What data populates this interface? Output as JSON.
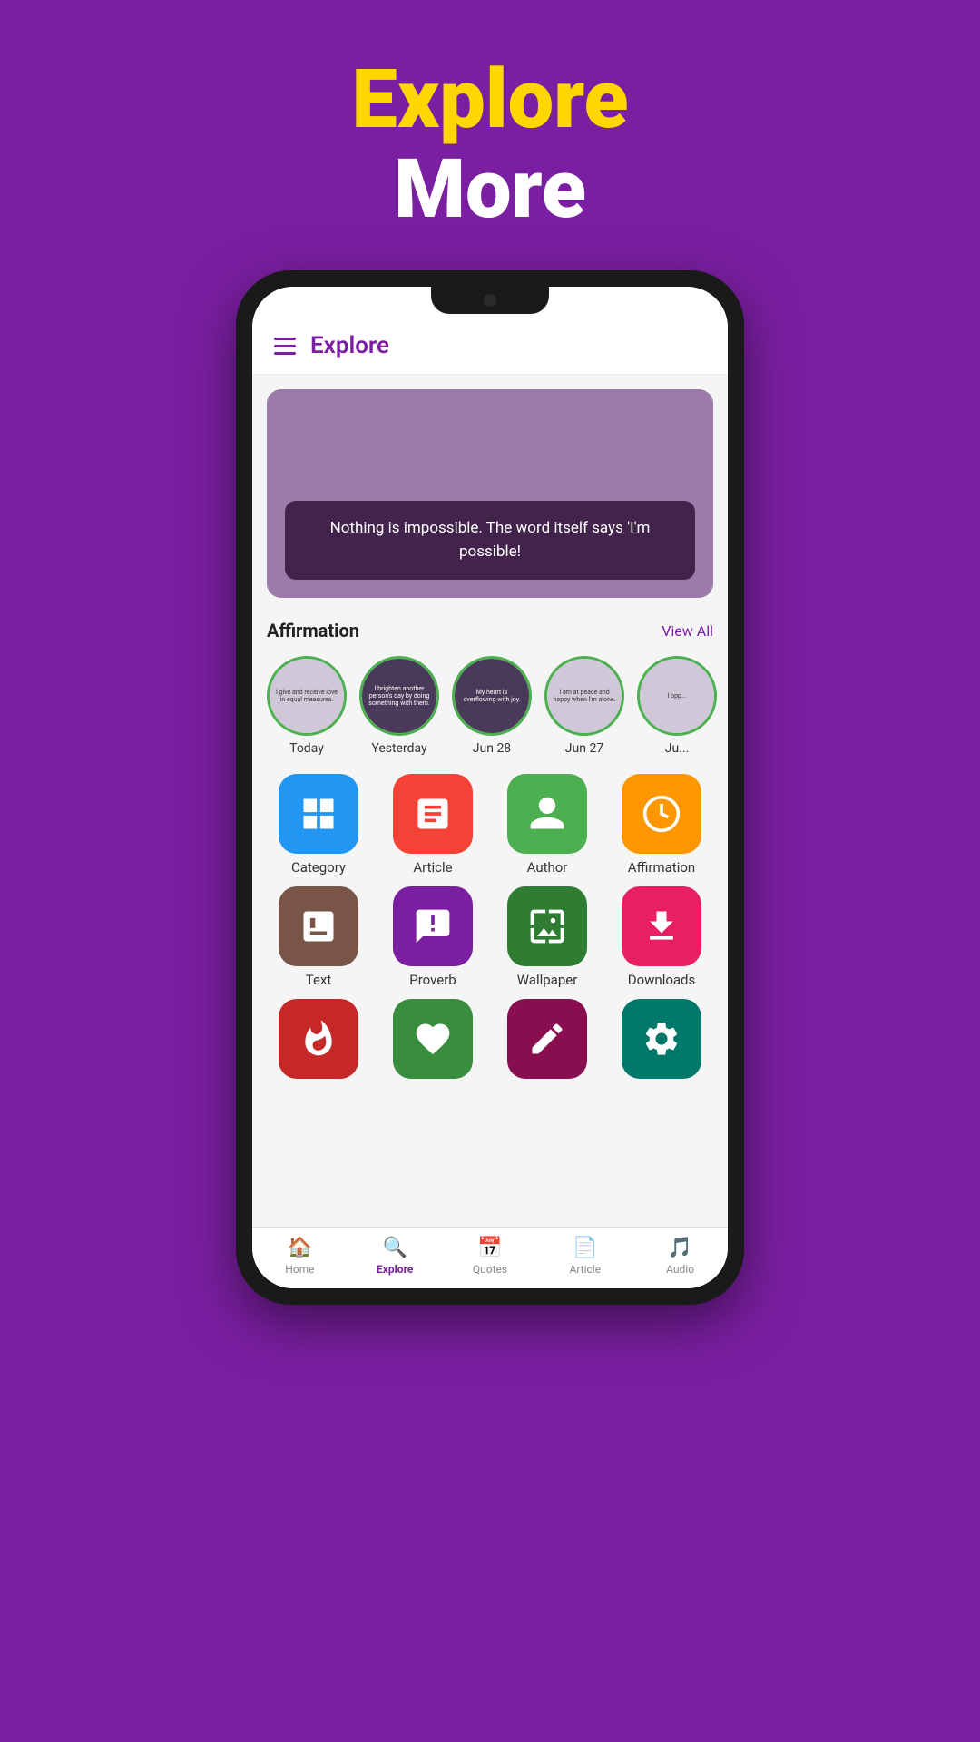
{
  "header": {
    "line1": "Explore",
    "line2": "More"
  },
  "screen": {
    "title": "Explore",
    "banner_quote": "Nothing is impossible. The word itself says 'I'm possible!",
    "affirmation_section": {
      "title": "Affirmation",
      "view_all": "View All",
      "items": [
        {
          "label": "Today",
          "text": "I give and receive love in equal measures."
        },
        {
          "label": "Yesterday",
          "text": "I brighten another person's day by doing something with them."
        },
        {
          "label": "Jun 28",
          "text": "My heart is overflowing with joy."
        },
        {
          "label": "Jun 27",
          "text": "I am at peace and happy when I'm alone."
        },
        {
          "label": "Ju...",
          "text": "I opp..."
        }
      ]
    },
    "grid_rows": [
      [
        {
          "label": "Category",
          "icon": "category",
          "color": "icon-blue"
        },
        {
          "label": "Article",
          "icon": "article",
          "color": "icon-red"
        },
        {
          "label": "Author",
          "icon": "author",
          "color": "icon-green"
        },
        {
          "label": "Affirmation",
          "icon": "affirmation",
          "color": "icon-orange"
        }
      ],
      [
        {
          "label": "Text",
          "icon": "text",
          "color": "icon-brown"
        },
        {
          "label": "Proverb",
          "icon": "proverb",
          "color": "icon-purple"
        },
        {
          "label": "Wallpaper",
          "icon": "wallpaper",
          "color": "icon-dark-green"
        },
        {
          "label": "Downloads",
          "icon": "downloads",
          "color": "icon-pink"
        }
      ],
      [
        {
          "label": "",
          "icon": "fire",
          "color": "icon-red-dark"
        },
        {
          "label": "",
          "icon": "heart",
          "color": "icon-green-mid"
        },
        {
          "label": "",
          "icon": "edit",
          "color": "icon-maroon"
        },
        {
          "label": "",
          "icon": "settings",
          "color": "icon-teal"
        }
      ]
    ],
    "nav": [
      {
        "label": "Home",
        "icon": "home",
        "active": false
      },
      {
        "label": "Explore",
        "icon": "explore",
        "active": true
      },
      {
        "label": "Quotes",
        "icon": "quotes",
        "active": false
      },
      {
        "label": "Article",
        "icon": "article",
        "active": false
      },
      {
        "label": "Audio",
        "icon": "audio",
        "active": false
      }
    ]
  }
}
